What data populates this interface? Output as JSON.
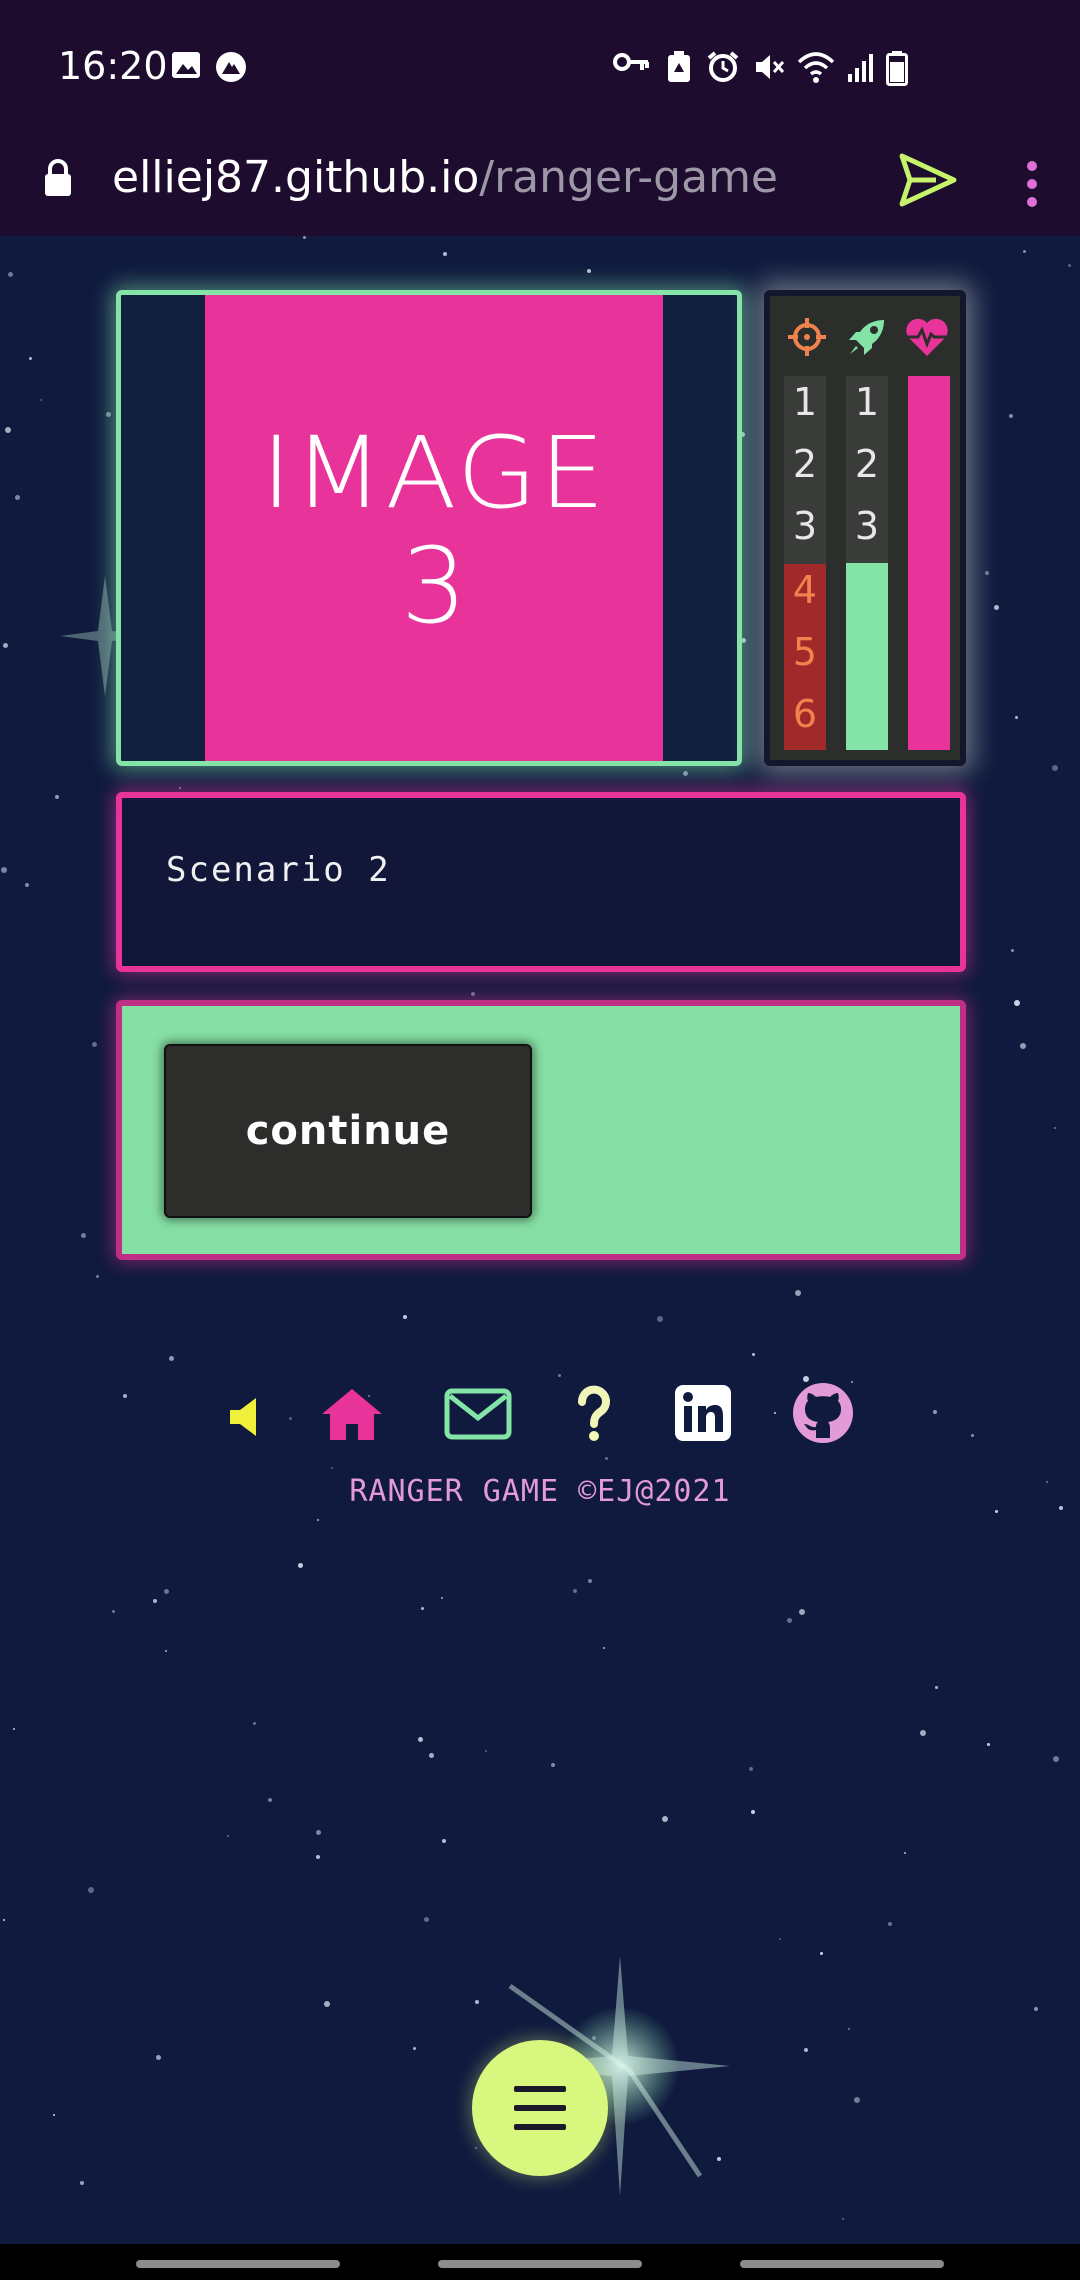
{
  "status_bar": {
    "time": "16:20"
  },
  "browser": {
    "url_host": "elliej87.github.io",
    "url_path": "/ranger-game"
  },
  "game": {
    "image_line1": "IMAGE",
    "image_line2": "3",
    "stats": {
      "target_numbers": [
        "1",
        "2",
        "3",
        "4",
        "5",
        "6"
      ],
      "ship_numbers": [
        "1",
        "2",
        "3"
      ],
      "ship_level_fraction": 0.5,
      "health_level_fraction": 1.0
    },
    "scenario_text": "Scenario 2",
    "continue_label": "continue"
  },
  "footer": {
    "text": "RANGER GAME ©EJ@2021"
  },
  "icons": {
    "sound": "speaker-icon",
    "home": "home-icon",
    "mail": "mail-icon",
    "help": "question-icon",
    "linkedin": "linkedin-icon",
    "github": "github-icon",
    "menu": "hamburger-icon"
  },
  "colors": {
    "background": "#0f1a3e",
    "pink": "#e8339b",
    "green": "#84e3a7",
    "orange": "#f0834d",
    "lime": "#d7f77e",
    "yellow": "#f0f03a",
    "footer_text": "#e39bd7"
  }
}
